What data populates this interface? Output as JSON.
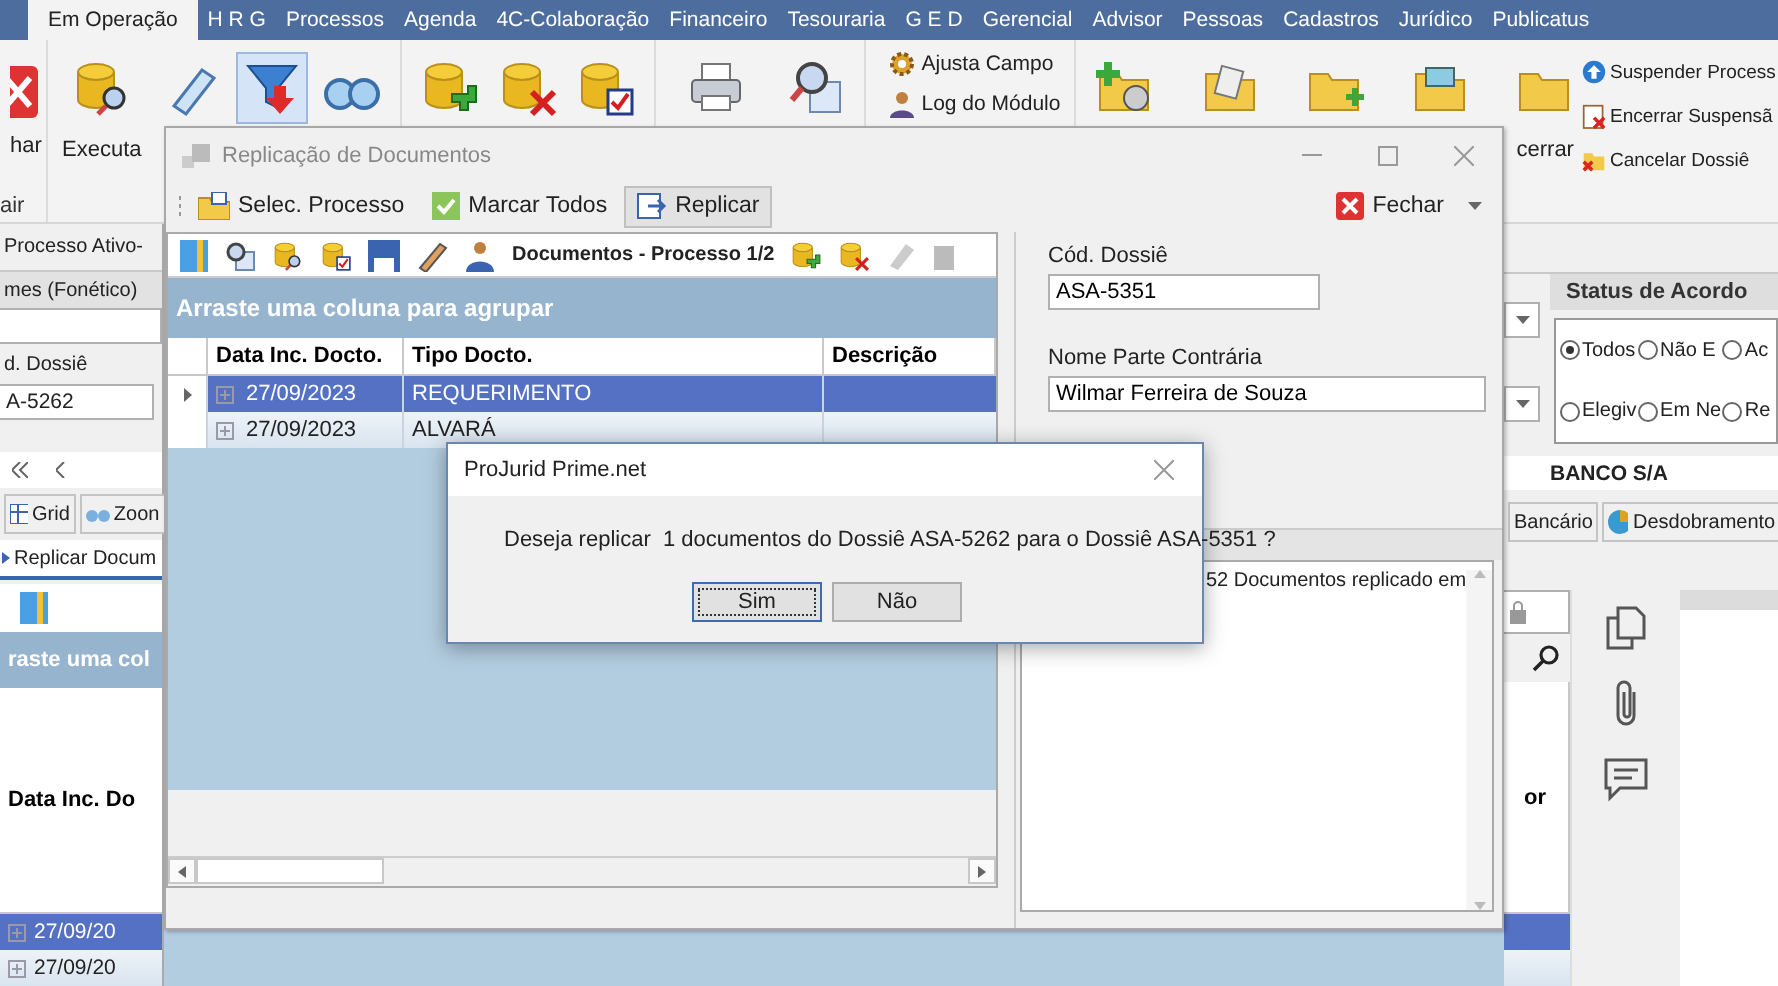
{
  "menu_tabs": [
    {
      "label": "Em Operação",
      "selected": true
    },
    {
      "label": "H R G",
      "selected": false
    },
    {
      "label": "Processos",
      "selected": false
    },
    {
      "label": "Agenda",
      "selected": false
    },
    {
      "label": "4C-Colaboração",
      "selected": false
    },
    {
      "label": "Financeiro",
      "selected": false
    },
    {
      "label": "Tesouraria",
      "selected": false
    },
    {
      "label": "G E D",
      "selected": false
    },
    {
      "label": "Gerencial",
      "selected": false
    },
    {
      "label": "Advisor",
      "selected": false
    },
    {
      "label": "Pessoas",
      "selected": false
    },
    {
      "label": "Cadastros",
      "selected": false
    },
    {
      "label": "Jurídico",
      "selected": false
    },
    {
      "label": "Publicatus",
      "selected": false
    }
  ],
  "ribbon": {
    "close_label": "har",
    "group_label": "air",
    "execute_label": "Executa",
    "small_actions": [
      "Ajusta Campo",
      "Log do Módulo"
    ],
    "folder_label": "cerrar",
    "side_actions": [
      "Suspender Process",
      "Encerrar Suspensã",
      "Cancelar Dossiê"
    ]
  },
  "left_panel": {
    "filter_value": "Processo Ativo-",
    "column_header": "mes (Fonético)",
    "dossier_label": "d. Dossiê",
    "dossier_value": "A-5262",
    "tabs": [
      {
        "label": "Grid",
        "selected": false
      },
      {
        "label": "Zoon",
        "selected": false
      }
    ],
    "sub_tab": "Replicar Docum",
    "group_hint": "raste uma col",
    "column": "Data Inc. Do",
    "rows": [
      {
        "date": "27/09/20",
        "selected": true
      },
      {
        "date": "27/09/20",
        "selected": false
      }
    ]
  },
  "right_panel": {
    "agreement_title": "Status de Acordo",
    "radios": [
      {
        "label": "Todos",
        "selected": true
      },
      {
        "label": "Não E",
        "selected": false
      },
      {
        "label": "Ac",
        "selected": false
      },
      {
        "label": "Elegiv",
        "selected": false
      },
      {
        "label": "Em Ne",
        "selected": false
      },
      {
        "label": "Re",
        "selected": false
      }
    ],
    "bank": "BANCO S/A",
    "tabs": [
      {
        "label": "Bancário",
        "selected": false
      },
      {
        "label": "Desdobramento",
        "selected": false
      }
    ],
    "column": "or",
    "rows": [
      {
        "selected": true
      },
      {
        "selected": false
      }
    ]
  },
  "replication_window": {
    "title": "Replicação de Documentos",
    "toolbar": [
      {
        "label": "Selec. Processo",
        "pressed": false
      },
      {
        "label": "Marcar Todos",
        "pressed": false
      },
      {
        "label": "Replicar",
        "pressed": true
      }
    ],
    "close_label": "Fechar",
    "grid_title": "Documentos - Processo 1/2",
    "group_hint": "Arraste uma coluna para agrupar",
    "columns": [
      "Data Inc. Docto.",
      "Tipo Docto.",
      "Descrição"
    ],
    "rows": [
      {
        "date": "27/09/2023",
        "type": "REQUERIMENTO",
        "selected": true
      },
      {
        "date": "27/09/2023",
        "type": "ALVARÁ",
        "selected": false
      }
    ],
    "dossier_label": "Cód. Dossiê",
    "dossier_value": "ASA-5351",
    "party_label": "Nome Parte Contrária",
    "party_value": "Wilmar Ferreira de Souza",
    "log_text": "52 Documentos replicado em"
  },
  "dialog": {
    "title": "ProJurid Prime.net",
    "message": "Deseja replicar  1 documentos do Dossiê ASA-5262 para o Dossiê ASA-5351 ?",
    "buttons": [
      {
        "label": "Sim",
        "focused": true
      },
      {
        "label": "Não",
        "focused": false
      }
    ]
  }
}
